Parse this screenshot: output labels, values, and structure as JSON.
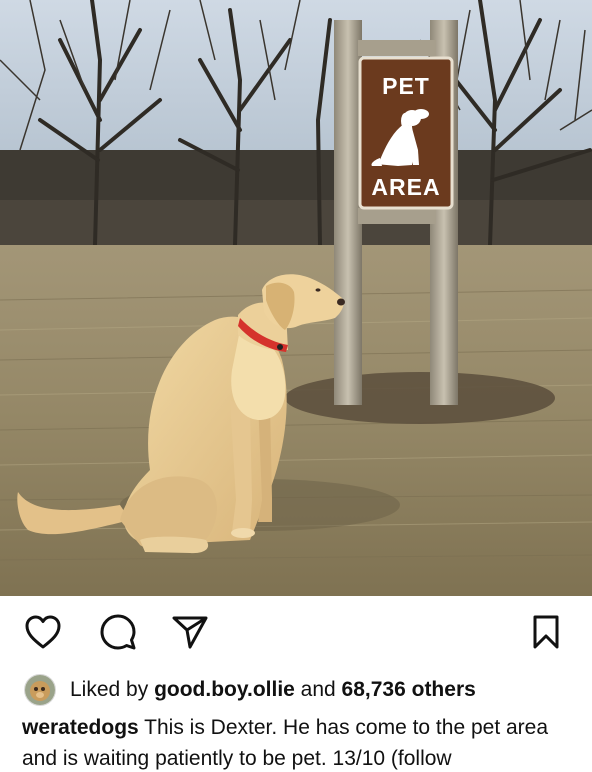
{
  "photo": {
    "sign": {
      "top_text": "PET",
      "bottom_text": "AREA"
    }
  },
  "actions": {
    "like_icon": "heart-outline-icon",
    "comment_icon": "speech-bubble-icon",
    "share_icon": "paper-plane-icon",
    "save_icon": "bookmark-outline-icon"
  },
  "likes": {
    "prefix": "Liked by ",
    "user": "good.boy.ollie",
    "middle": " and ",
    "count": "68,736 others"
  },
  "caption": {
    "username": "weratedogs",
    "text": " This is Dexter. He has come to the pet area and is waiting patiently to be pet. 13/10 (follow"
  },
  "colors": {
    "sign_brown": "#6b3a1e",
    "icon_color": "#111111"
  }
}
